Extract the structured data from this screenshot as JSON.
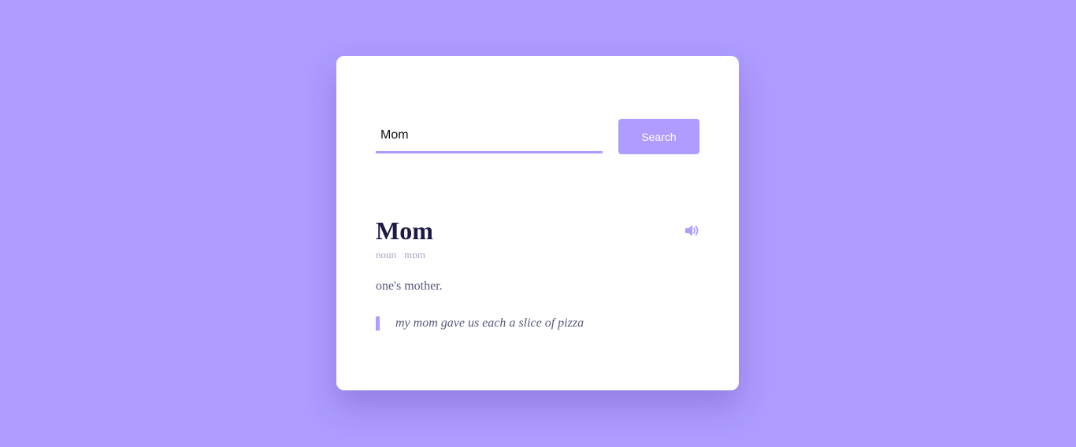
{
  "search": {
    "value": "Mom",
    "button_label": "Search"
  },
  "result": {
    "word": "Mom",
    "part_of_speech": "noun",
    "phonetic": "mɒm",
    "meaning": "one's mother.",
    "example": "my mom gave us each a slice of pizza",
    "sound_icon": "volume-up-icon"
  },
  "colors": {
    "background": "#ae9cff",
    "accent": "#ae9cff",
    "card": "#ffffff",
    "word": "#1c1a43",
    "text": "#575a7b",
    "muted": "#a9a6c4"
  }
}
